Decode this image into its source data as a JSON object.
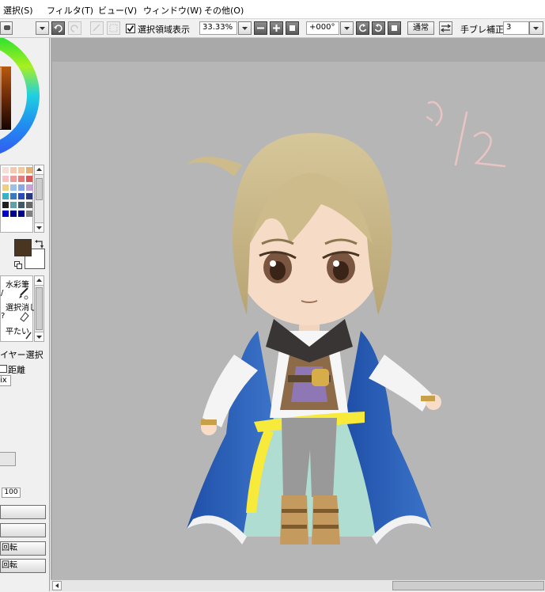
{
  "menubar": {
    "items": [
      {
        "label": "選択(S)",
        "name": "menu-select"
      },
      {
        "label": "フィルタ(T)",
        "name": "menu-filter"
      },
      {
        "label": "ビュー(V)",
        "name": "menu-view"
      },
      {
        "label": "ウィンドウ(W)",
        "name": "menu-window"
      },
      {
        "label": "その他(O)",
        "name": "menu-other"
      }
    ]
  },
  "toolbar": {
    "selection_display_label": "選択領域表示",
    "selection_display_checked": true,
    "zoom_value": "33.33%",
    "rotation_value": "+000°",
    "blend_mode_label": "通常",
    "stabilizer_label": "手ブレ補正",
    "stabilizer_value": "3"
  },
  "left_panel": {
    "brush_tools": [
      {
        "label": "水彩筆"
      },
      {
        "label": "選択消し"
      },
      {
        "label": "平たい"
      }
    ],
    "layer_select_label": "イヤー選択",
    "distance_label": "距離",
    "dropdown_value": "ix",
    "opacity_value": "100",
    "buttons": [
      {
        "label": ""
      },
      {
        "label": ""
      },
      {
        "label": "回転"
      },
      {
        "label": "回転"
      }
    ]
  },
  "colors": {
    "primary": "#4a3520",
    "secondary": "#ffffff",
    "palette": [
      "#f4e0d8",
      "#f5c9b0",
      "#f3c99a",
      "#e3b07a",
      "#f8c0c0",
      "#ee9a9a",
      "#e57a7a",
      "#d65a5a",
      "#f0d080",
      "#9cc0e8",
      "#8aa8e8",
      "#c8a0d8",
      "#38b0c8",
      "#3a7ac0",
      "#2a4ab8",
      "#283880",
      "#202020",
      "#60a0a8",
      "#405868",
      "#686868",
      "#0000c8",
      "#000090",
      "#00008a",
      "#808080"
    ]
  },
  "canvas": {
    "annotation_text": "7/2"
  }
}
